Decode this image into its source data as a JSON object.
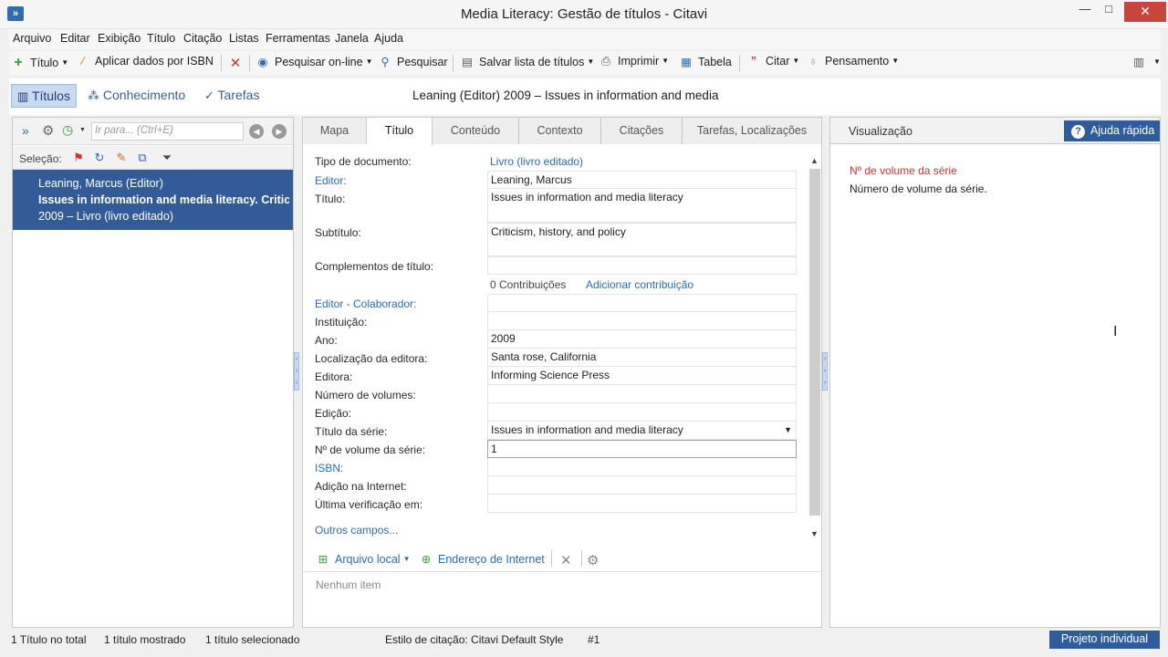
{
  "window": {
    "app_icon": "»",
    "title": "Media Literacy: Gestão de títulos - Citavi",
    "min": "—",
    "max": "□",
    "close": "✕"
  },
  "menu": [
    "Arquivo",
    "Editar",
    "Exibição",
    "Título",
    "Citação",
    "Listas",
    "Ferramentas",
    "Janela",
    "Ajuda"
  ],
  "toolbar": {
    "titulo": "Título",
    "isbn": "Aplicar dados por ISBN",
    "pesquisar_online": "Pesquisar on-line",
    "pesquisar": "Pesquisar",
    "salvar_lista": "Salvar lista de títulos",
    "imprimir": "Imprimir",
    "tabela": "Tabela",
    "citar": "Citar",
    "pensamento": "Pensamento"
  },
  "nav": {
    "titulos": "Títulos",
    "conhecimento": "Conhecimento",
    "tarefas": "Tarefas",
    "selected_title": "Leaning (Editor) 2009 – Issues in information and media"
  },
  "left": {
    "search_placeholder": "Ir para... (Ctrl+E)",
    "selection_label": "Seleção:",
    "item": {
      "author": "Leaning, Marcus (Editor)",
      "title": "Issues in information and media literacy. Criticism,",
      "meta": "2009 – Livro (livro editado)"
    }
  },
  "tabs": [
    "Mapa",
    "Título",
    "Conteúdo",
    "Contexto",
    "Citações",
    "Tarefas, Localizações"
  ],
  "form": {
    "tipo_documento": {
      "label": "Tipo de documento:",
      "value": "Livro (livro editado)"
    },
    "editor": {
      "label": "Editor:",
      "value": "Leaning, Marcus"
    },
    "titulo": {
      "label": "Título:",
      "value": "Issues in information and media literacy"
    },
    "subtitulo": {
      "label": "Subtítulo:",
      "value": "Criticism, history, and policy"
    },
    "complementos": {
      "label": "Complementos de título:",
      "value": ""
    },
    "contribuicoes": "0 Contribuições",
    "adicionar_contribuicao": "Adicionar contribuição",
    "editor_colaborador": {
      "label": "Editor - Colaborador:",
      "value": ""
    },
    "instituicao": {
      "label": "Instituição:",
      "value": ""
    },
    "ano": {
      "label": "Ano:",
      "value": "2009"
    },
    "localizacao": {
      "label": "Localização da editora:",
      "value": "Santa rose, California"
    },
    "editora": {
      "label": "Editora:",
      "value": "Informing Science Press"
    },
    "num_volumes": {
      "label": "Número de volumes:",
      "value": ""
    },
    "edicao": {
      "label": "Edição:",
      "value": ""
    },
    "titulo_serie": {
      "label": "Título da série:",
      "value": "Issues in information and media literacy"
    },
    "volume_serie": {
      "label": "Nº de volume da série:",
      "value": "1"
    },
    "isbn": {
      "label": "ISBN:",
      "value": ""
    },
    "adicao_internet": {
      "label": "Adição na Internet:",
      "value": ""
    },
    "ultima_verificacao": {
      "label": "Última verificação em:",
      "value": ""
    },
    "outros_campos": "Outros campos..."
  },
  "attachments": {
    "arquivo_local": "Arquivo local",
    "endereco_internet": "Endereço de Internet",
    "empty": "Nenhum item"
  },
  "right": {
    "header": "Visualização",
    "help_button": "Ajuda rápida",
    "help_title": "Nº de volume da série",
    "help_text": "Número de volume da série."
  },
  "status": {
    "total": "1 Título no total",
    "mostrado": "1 título mostrado",
    "selecionado": "1 título selecionado",
    "estilo": "Estilo de citação: Citavi Default Style",
    "num": "#1",
    "projeto": "Projeto individual"
  },
  "colors": {
    "accent": "#2e5d99",
    "selection": "#335b97",
    "link": "#2b6cb0",
    "help_title": "#d0322e",
    "close_button": "#c7463c"
  },
  "icons": [
    "app-icon",
    "plus-icon",
    "wand-icon",
    "delete-icon",
    "globe-search-icon",
    "search-icon",
    "save-list-icon",
    "printer-icon",
    "table-icon",
    "quote-icon",
    "lightbulb-icon",
    "layout-icon",
    "titles-icon",
    "knowledge-icon",
    "tasks-icon",
    "gear-icon",
    "history-icon",
    "back-icon",
    "forward-icon",
    "flag-icon",
    "refresh-icon",
    "tag-icon",
    "copy-icon",
    "filter-icon",
    "local-file-icon",
    "web-address-icon",
    "close-icon",
    "help-icon",
    "text-cursor-icon"
  ]
}
